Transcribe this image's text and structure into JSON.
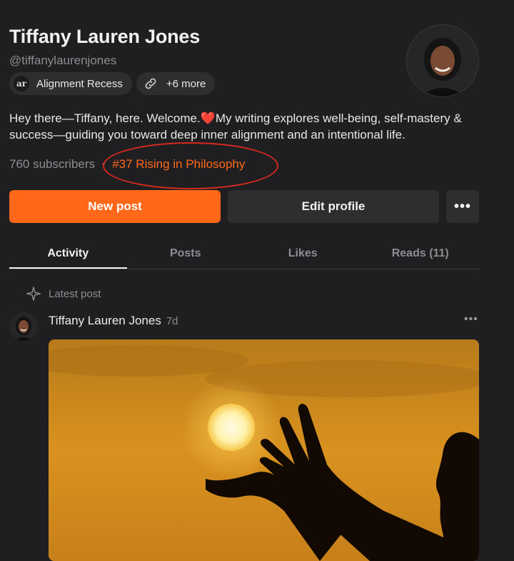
{
  "profile": {
    "name": "Tiffany Lauren Jones",
    "handle": "@tiffanylaurenjones",
    "chips": [
      {
        "icon": "ar",
        "label": "Alignment Recess"
      },
      {
        "icon": "link-icon",
        "label": "+6 more"
      }
    ],
    "bio_part1": "Hey there—Tiffany, here. Welcome.",
    "bio_heart": "❤️",
    "bio_part2": "My writing explores well-being, self-mastery & success—guiding you toward deep inner alignment and an intentional life.",
    "subscribers": "760 subscribers",
    "separator": "•",
    "rank": "#37 Rising in Philosophy"
  },
  "actions": {
    "new_post": "New post",
    "edit_profile": "Edit profile",
    "more": "•••"
  },
  "tabs": [
    {
      "label": "Activity",
      "active": true
    },
    {
      "label": "Posts",
      "active": false
    },
    {
      "label": "Likes",
      "active": false
    },
    {
      "label": "Reads (11)",
      "active": false
    }
  ],
  "feed": {
    "section_label": "Latest post",
    "post": {
      "author": "Tiffany Lauren Jones",
      "time": "7d",
      "more": "•••"
    }
  },
  "colors": {
    "accent": "#ff6719",
    "rank_text": "#ff6a1a",
    "annotation": "#d62a1f",
    "background": "#1f1f21"
  }
}
